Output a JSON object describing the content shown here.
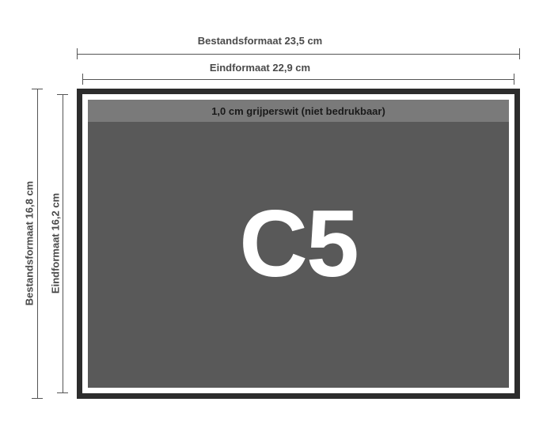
{
  "dimensions": {
    "bleed_width_label": "Bestandsformaat 23,5 cm",
    "trim_width_label": "Eindformaat 22,9 cm",
    "bleed_height_label": "Bestandsformaat 16,8 cm",
    "trim_height_label": "Eindformaat 16,2 cm",
    "gripper_label": "1,0 cm grijperswit (niet bedrukbaar)"
  },
  "format": {
    "name": "C5"
  }
}
